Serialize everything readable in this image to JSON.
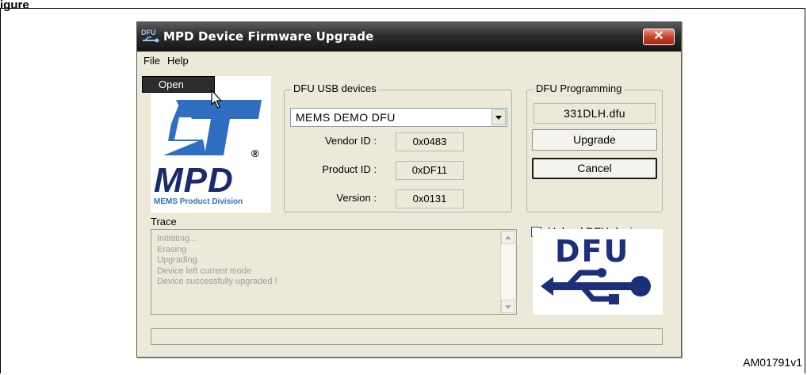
{
  "figure_label": "igure",
  "reference_id": "AM01791v1",
  "window": {
    "title": "MPD Device Firmware Upgrade",
    "close_symbol": "✕"
  },
  "menu": {
    "items": [
      "File",
      "Help"
    ],
    "open_dropdown_item": "Open"
  },
  "logo": {
    "main_text": "MPD",
    "sub_text": "MEMS Product Division",
    "registered_mark": "®"
  },
  "usb_devices": {
    "legend": "DFU USB devices",
    "selected_device": "MEMS DEMO DFU",
    "rows": [
      {
        "label": "Vendor ID :",
        "value": "0x0483"
      },
      {
        "label": "Product ID :",
        "value": "0xDF11"
      },
      {
        "label": "Version :",
        "value": "0x0131"
      }
    ]
  },
  "programming": {
    "legend": "DFU Programming",
    "file_name": "331DLH.dfu",
    "upgrade_label": "Upgrade",
    "cancel_label": "Cancel",
    "upload_label": "Upload DFU device",
    "upload_checked": false
  },
  "trace": {
    "label": "Trace",
    "lines": [
      "Initiating...",
      "Erasing",
      "Upgrading",
      "Device left current mode",
      "Device successfully upgraded !"
    ]
  },
  "dfu_logo": {
    "text": "DFU"
  },
  "progress": {
    "value": 0
  },
  "colors": {
    "st_blue": "#2f6ec2",
    "mpd_navy": "#1b2a6e",
    "dfu_navy": "#1d2f7a"
  }
}
